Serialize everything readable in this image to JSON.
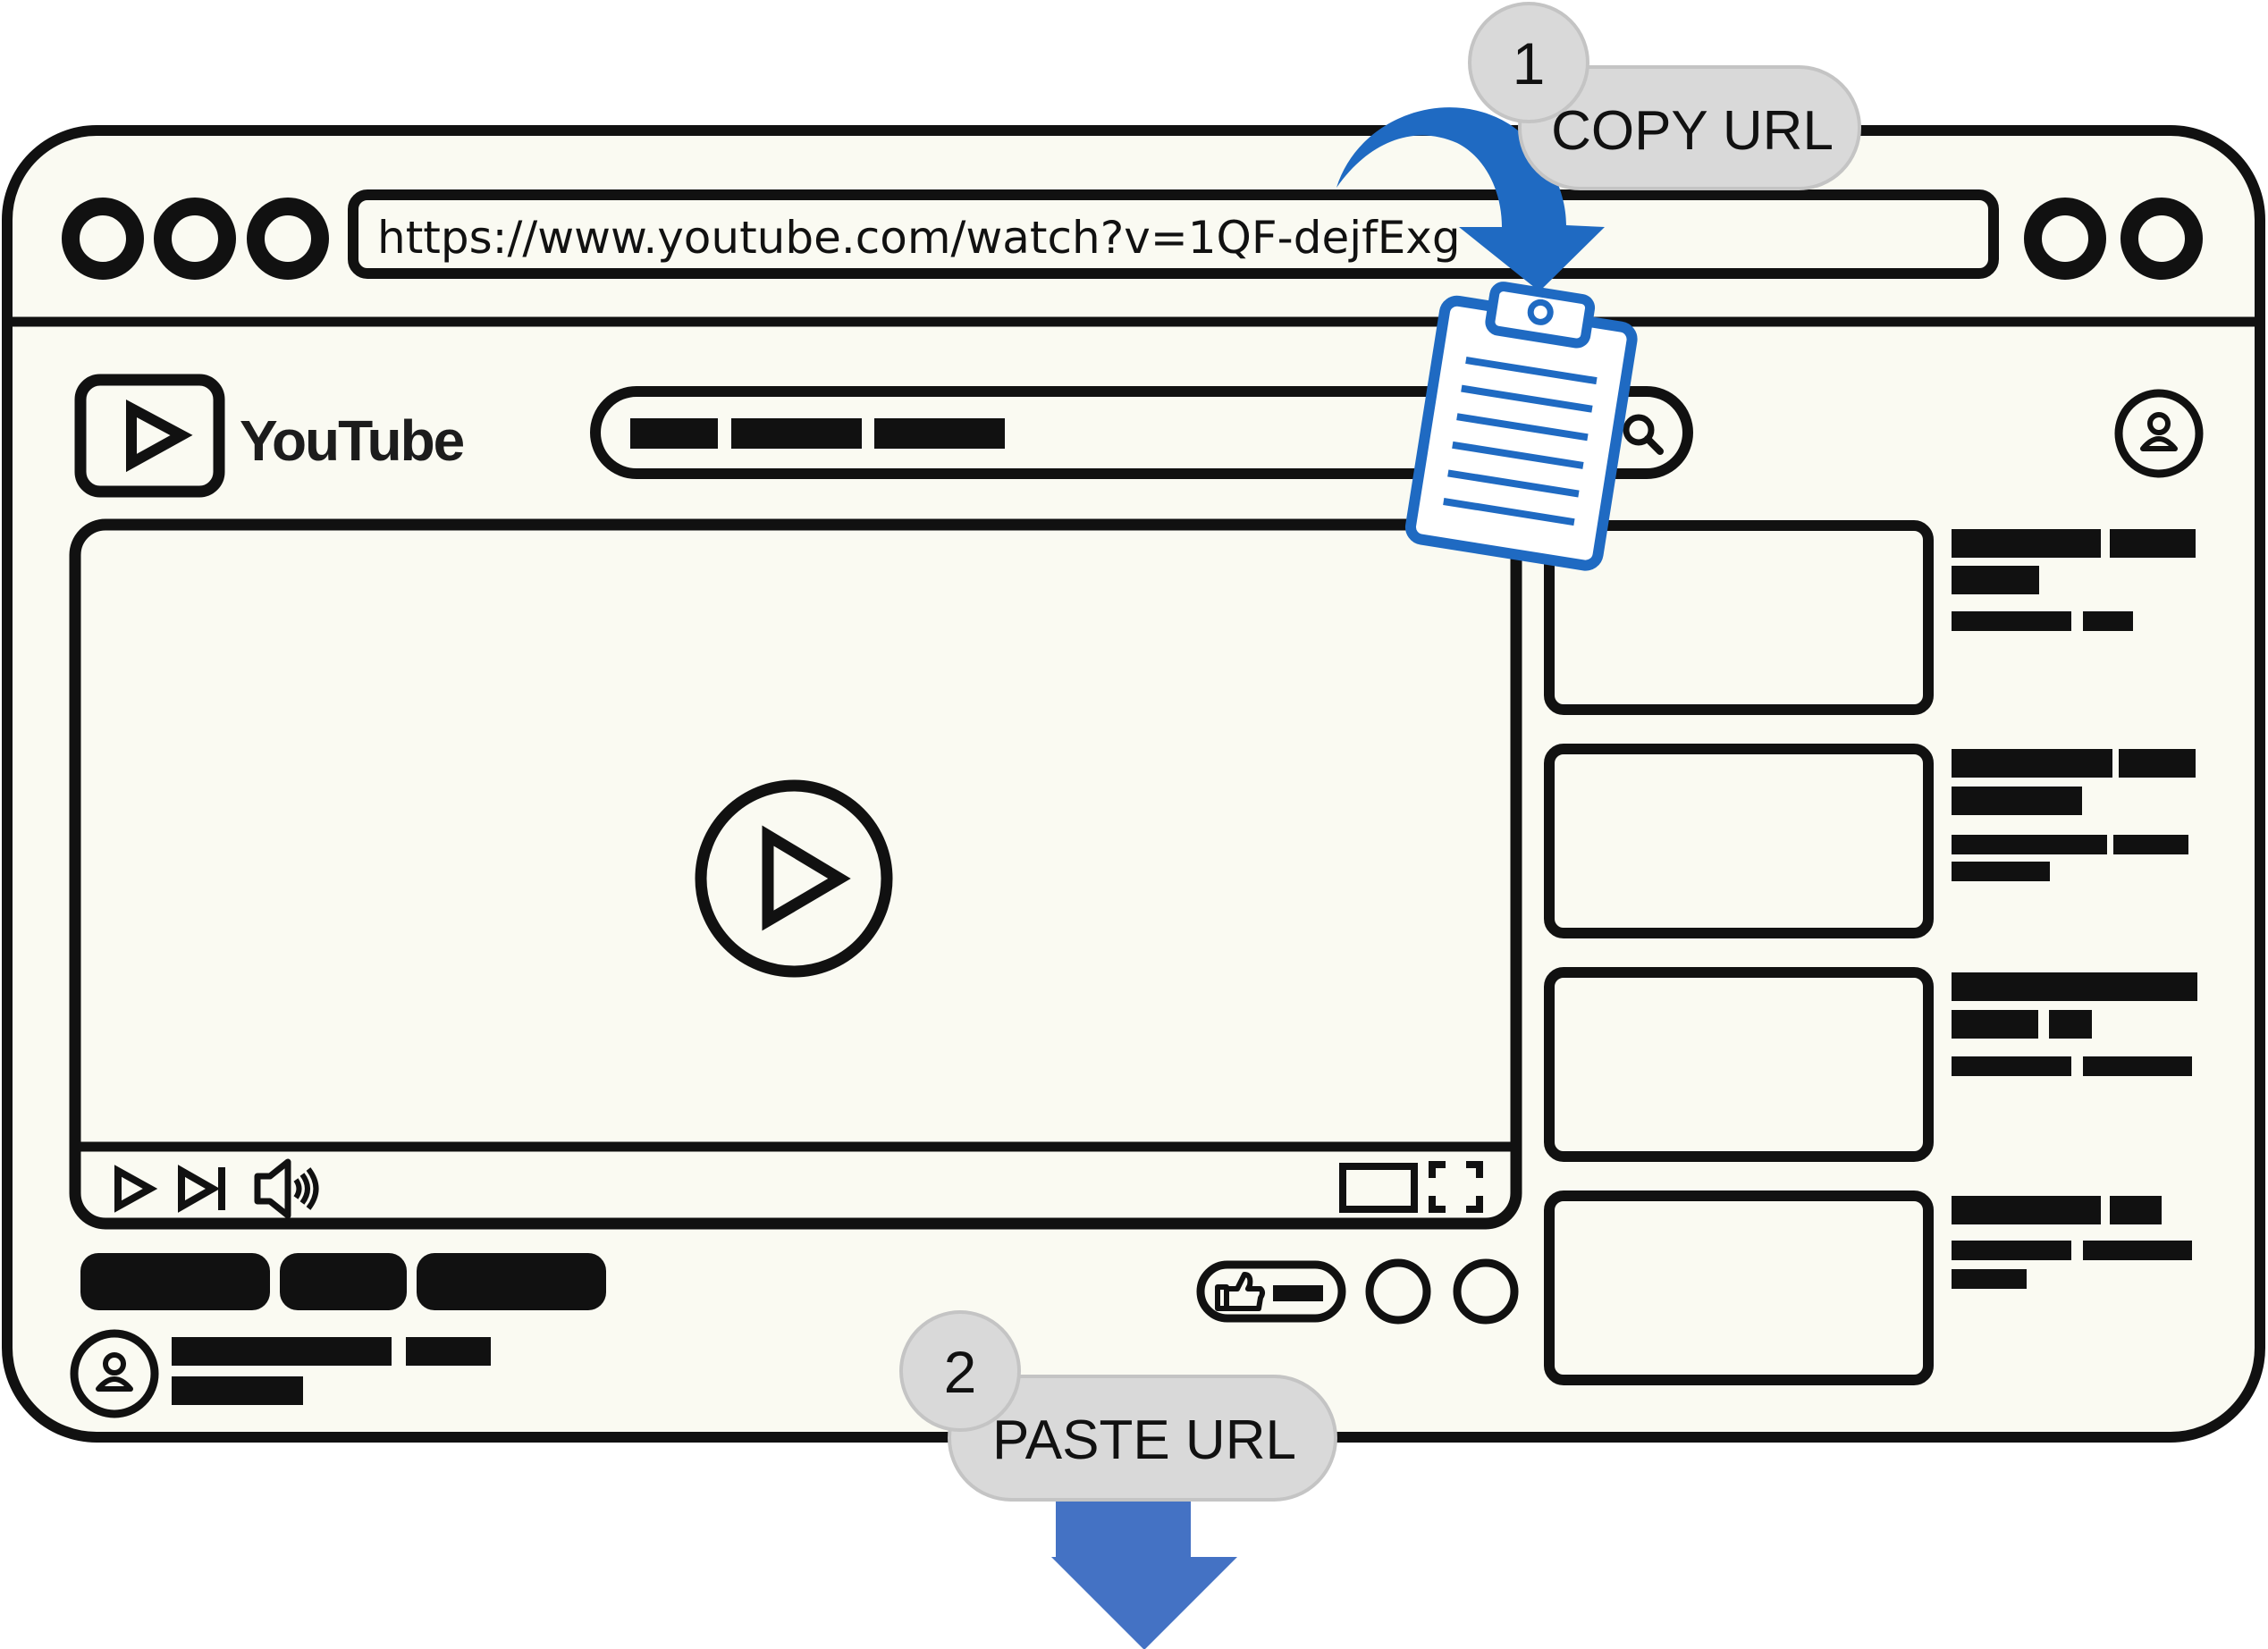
{
  "browser": {
    "address_bar": {
      "url": "https://www.youtube.com/watch?v=1QF-dejfExg"
    }
  },
  "youtube": {
    "logo_text": "YouTube"
  },
  "steps": [
    {
      "number": "1",
      "label": "COPY URL"
    },
    {
      "number": "2",
      "label": "PASTE URL"
    }
  ],
  "icons": [
    "window-dot-icon",
    "play-icon",
    "search-icon",
    "account-icon",
    "skip-next-icon",
    "volume-icon",
    "theater-mode-icon",
    "fullscreen-icon",
    "thumbs-up-icon",
    "clipboard-icon",
    "curved-arrow-icon",
    "down-arrow-icon"
  ],
  "colors": {
    "window_bg": "#fafaf2",
    "outline": "#111111",
    "accent_blue": "#1f6ac2",
    "arrow_blue": "#4472c4",
    "bubble_fill": "#d9d9d9",
    "bubble_stroke": "#bfbfbf"
  }
}
